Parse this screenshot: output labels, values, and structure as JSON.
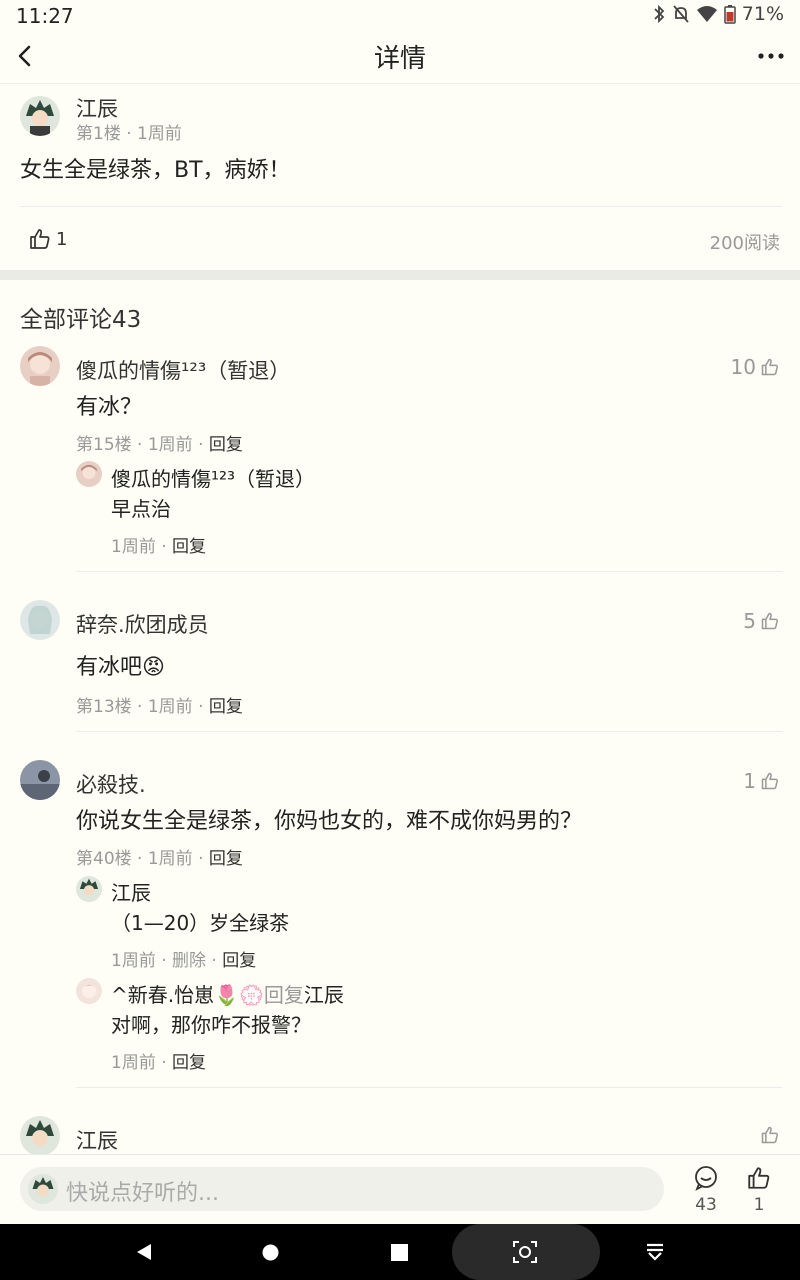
{
  "status": {
    "time": "11:27",
    "battery": "71%"
  },
  "header": {
    "title": "详情"
  },
  "post": {
    "author": "江辰",
    "meta": "第1楼 · 1周前",
    "content": "女生全是绿茶，BT，病娇！",
    "likes": "1",
    "reads": "200阅读"
  },
  "comments_title": "全部评论43",
  "comments": [
    {
      "author": "傻瓜的情傷¹²³（暂退）",
      "content": "有冰？",
      "meta_prefix": "第15楼 · 1周前 · ",
      "reply_label": "回复",
      "likes": "10",
      "replies": [
        {
          "author": "傻瓜的情傷¹²³（暂退）",
          "content": "早点治",
          "meta_prefix": "1周前 · ",
          "reply_label": "回复"
        }
      ]
    },
    {
      "author": "辞奈.欣团成员",
      "content": "有冰吧😡",
      "meta_prefix": "第13楼 · 1周前 · ",
      "reply_label": "回复",
      "likes": "5"
    },
    {
      "author": "必殺技.",
      "content": "你说女生全是绿茶，你妈也女的，难不成你妈男的？",
      "meta_prefix": "第40楼 · 1周前 · ",
      "reply_label": "回复",
      "likes": "1",
      "replies": [
        {
          "author": "江辰",
          "content": "（1—20）岁全绿茶",
          "meta_prefix": "1周前 · 删除 · ",
          "reply_label": "回复"
        },
        {
          "author": "^新春.怡崽🌷💮",
          "reply_word": "回复",
          "reply_to": "江辰",
          "content": "对啊，那你咋不报警？",
          "meta_prefix": "1周前 · ",
          "reply_label": "回复"
        }
      ]
    },
    {
      "author": "江辰"
    }
  ],
  "bottom": {
    "placeholder": "快说点好听的...",
    "comment_count": "43",
    "like_count": "1"
  },
  "colors": {
    "background": "#fefef6",
    "muted": "#999999",
    "band": "#ebebe6"
  }
}
